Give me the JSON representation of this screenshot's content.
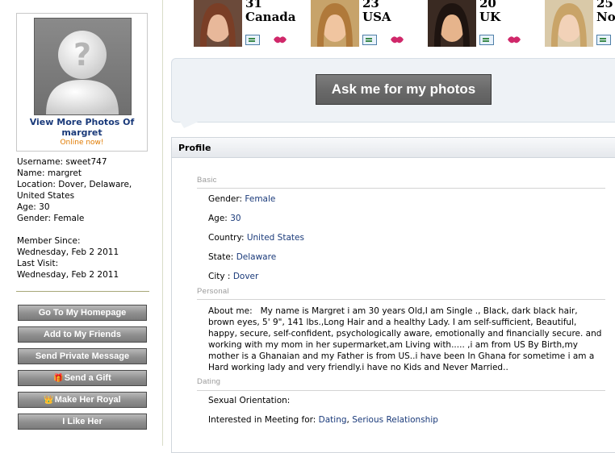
{
  "members": [
    {
      "age": "31",
      "country": "Canada"
    },
    {
      "age": "23",
      "country": "USA"
    },
    {
      "age": "20",
      "country": "UK"
    },
    {
      "age": "25",
      "country": "No"
    }
  ],
  "sidebar": {
    "view_more": "View More Photos Of margret",
    "online": "Online now!",
    "username": "Username: sweet747",
    "name": "Name: margret",
    "location": "Location: Dover, Delaware, United States",
    "age": "Age: 30",
    "gender": "Gender: Female",
    "member_since_label": "Member Since:",
    "member_since": "Wednesday, Feb 2 2011",
    "last_visit_label": "Last Visit:",
    "last_visit": "Wednesday, Feb 2 2011",
    "buttons": {
      "homepage": "Go To My Homepage",
      "friends": "Add to My Friends",
      "message": "Send Private Message",
      "gift": "Send a Gift",
      "royal": "Make Her Royal",
      "like": "I Like Her"
    }
  },
  "ask_button": "Ask me for my photos",
  "profile": {
    "title": "Profile",
    "basic_label": "Basic",
    "personal_label": "Personal",
    "dating_label": "Dating",
    "gender_label": "Gender:",
    "gender": "Female",
    "age_label": "Age:",
    "age": "30",
    "country_label": "Country:",
    "country": "United States",
    "state_label": "State:",
    "state": "Delaware",
    "city_label": "City :",
    "city": "Dover",
    "about_label": "About me:",
    "about": "My name is Margret i am 30 years Old,I am Single ., Black, dark black hair, brown eyes, 5' 9\", 141 lbs.,Long Hair and a healthy Lady. I am self-sufficient, Beautiful, happy, secure, self-confident, psychologically aware, emotionally and financially secure. and working with my mom in her supermarket,am Living with..... ,i am from US By Birth,my mother is a Ghanaian and my Father is from US..i have been In Ghana for sometime i am a Hard working lady and very friendly.i have no Kids and Never Married..",
    "orientation_label": "Sexual Orientation:",
    "interested_label": "Interested in Meeting for:",
    "interested_1": "Dating",
    "interested_sep": ",",
    "interested_2": "Serious Relationship"
  },
  "colors": {
    "link": "#1a3a7a",
    "online": "#e07a00",
    "button_gray": "#8e8e8e"
  }
}
